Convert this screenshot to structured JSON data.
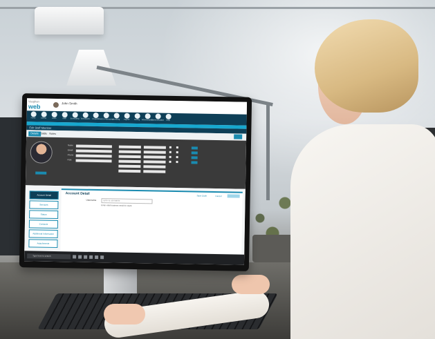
{
  "app": {
    "logo_text": "web",
    "logo_sub": "Vaughan",
    "user_name": "John Smith",
    "breadcrumb": "Edit Staff Member"
  },
  "toolbar": {
    "items": [
      "Home",
      "Clients",
      "Users",
      "Staff",
      "Scheduling",
      "Timesheets",
      "Reports",
      "Invoice Processing",
      "Invoicing",
      "Payroll",
      "Setting",
      "Administration",
      "Communication",
      "Help"
    ]
  },
  "tabs": {
    "t1": "Details",
    "t2": "Skills",
    "t3": "Notes"
  },
  "profile": {
    "field_labels": [
      "Name",
      "Email",
      "Phone",
      "Role"
    ]
  },
  "sidebar": {
    "items": [
      "Account Detail",
      "Services",
      "Status",
      "Contacts",
      "Additional Information",
      "Attachments"
    ]
  },
  "panel": {
    "title": "Account Detail",
    "action_1": "Save Draft",
    "action_2": "Cancel",
    "field_label": "Username",
    "field_placeholder": "Enter a username",
    "note": "Enter valid business email for client."
  },
  "taskbar": {
    "search_placeholder": "Type here to search"
  }
}
